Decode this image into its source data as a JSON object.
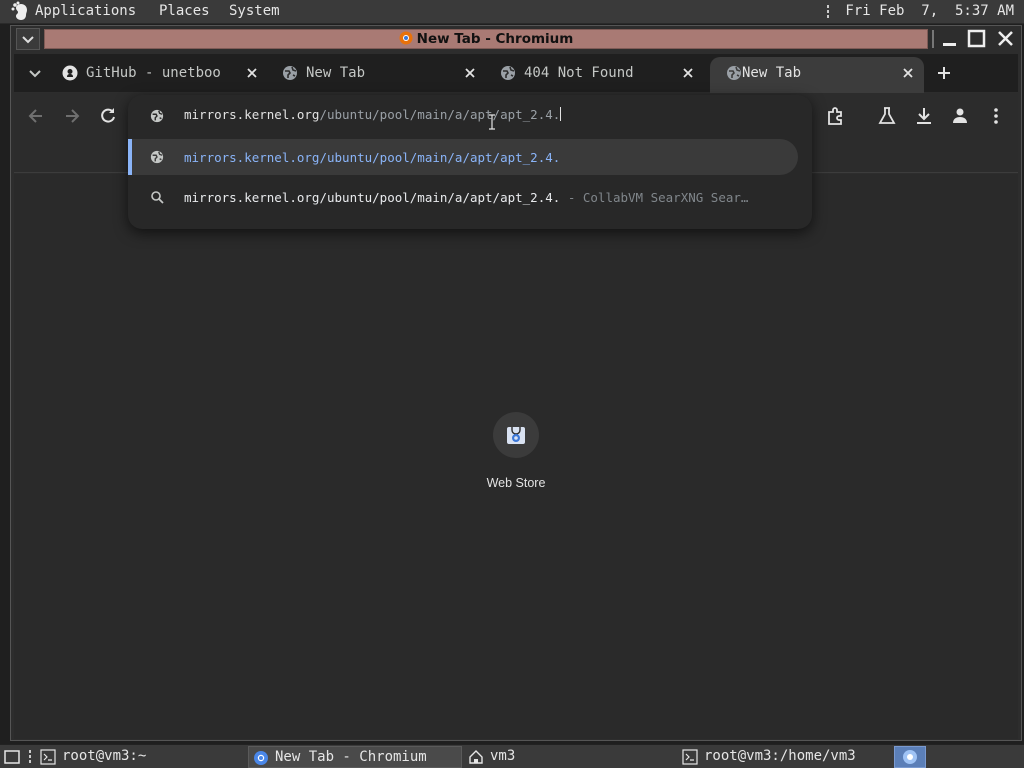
{
  "panel": {
    "menus": [
      "Applications",
      "Places",
      "System"
    ],
    "clock": "Fri Feb  7,  5:37 AM"
  },
  "window": {
    "title": "New Tab - Chromium"
  },
  "tabs": [
    {
      "label": "GitHub - unetboo",
      "favicon": "github-icon",
      "active": false
    },
    {
      "label": "New Tab",
      "favicon": "globe-icon",
      "active": false
    },
    {
      "label": "404 Not Found",
      "favicon": "globe-icon",
      "active": false
    },
    {
      "label": "New Tab",
      "favicon": "globe-icon",
      "active": true
    }
  ],
  "omnibox": {
    "typed": "mirrors.kernel.org",
    "autocomplete": "/ubuntu/pool/main/a/apt/apt_2.4.",
    "suggestions": [
      {
        "text": "mirrors.kernel.org/ubuntu/pool/main/a/apt/apt_2.4.",
        "desc": "",
        "icon": "globe-icon"
      },
      {
        "text": "mirrors.kernel.org/ubuntu/pool/main/a/apt/apt_2.4.",
        "desc": " - CollabVM SearXNG Sear…",
        "icon": "search-icon"
      }
    ]
  },
  "shortcuts": [
    {
      "label": "Web Store",
      "icon": "web-store-icon"
    }
  ],
  "taskbar": {
    "tasks": [
      {
        "label": "root@vm3:~",
        "icon": "terminal-icon"
      },
      {
        "label": "New Tab - Chromium",
        "icon": "chromium-icon"
      },
      {
        "label": "vm3",
        "icon": "home-folder-icon"
      },
      {
        "label": "root@vm3:/home/vm3",
        "icon": "terminal-icon"
      }
    ]
  },
  "colors": {
    "titlebar": "#a97a74",
    "accent": "#8ab4f8",
    "page_bg": "#2a2a2a"
  }
}
